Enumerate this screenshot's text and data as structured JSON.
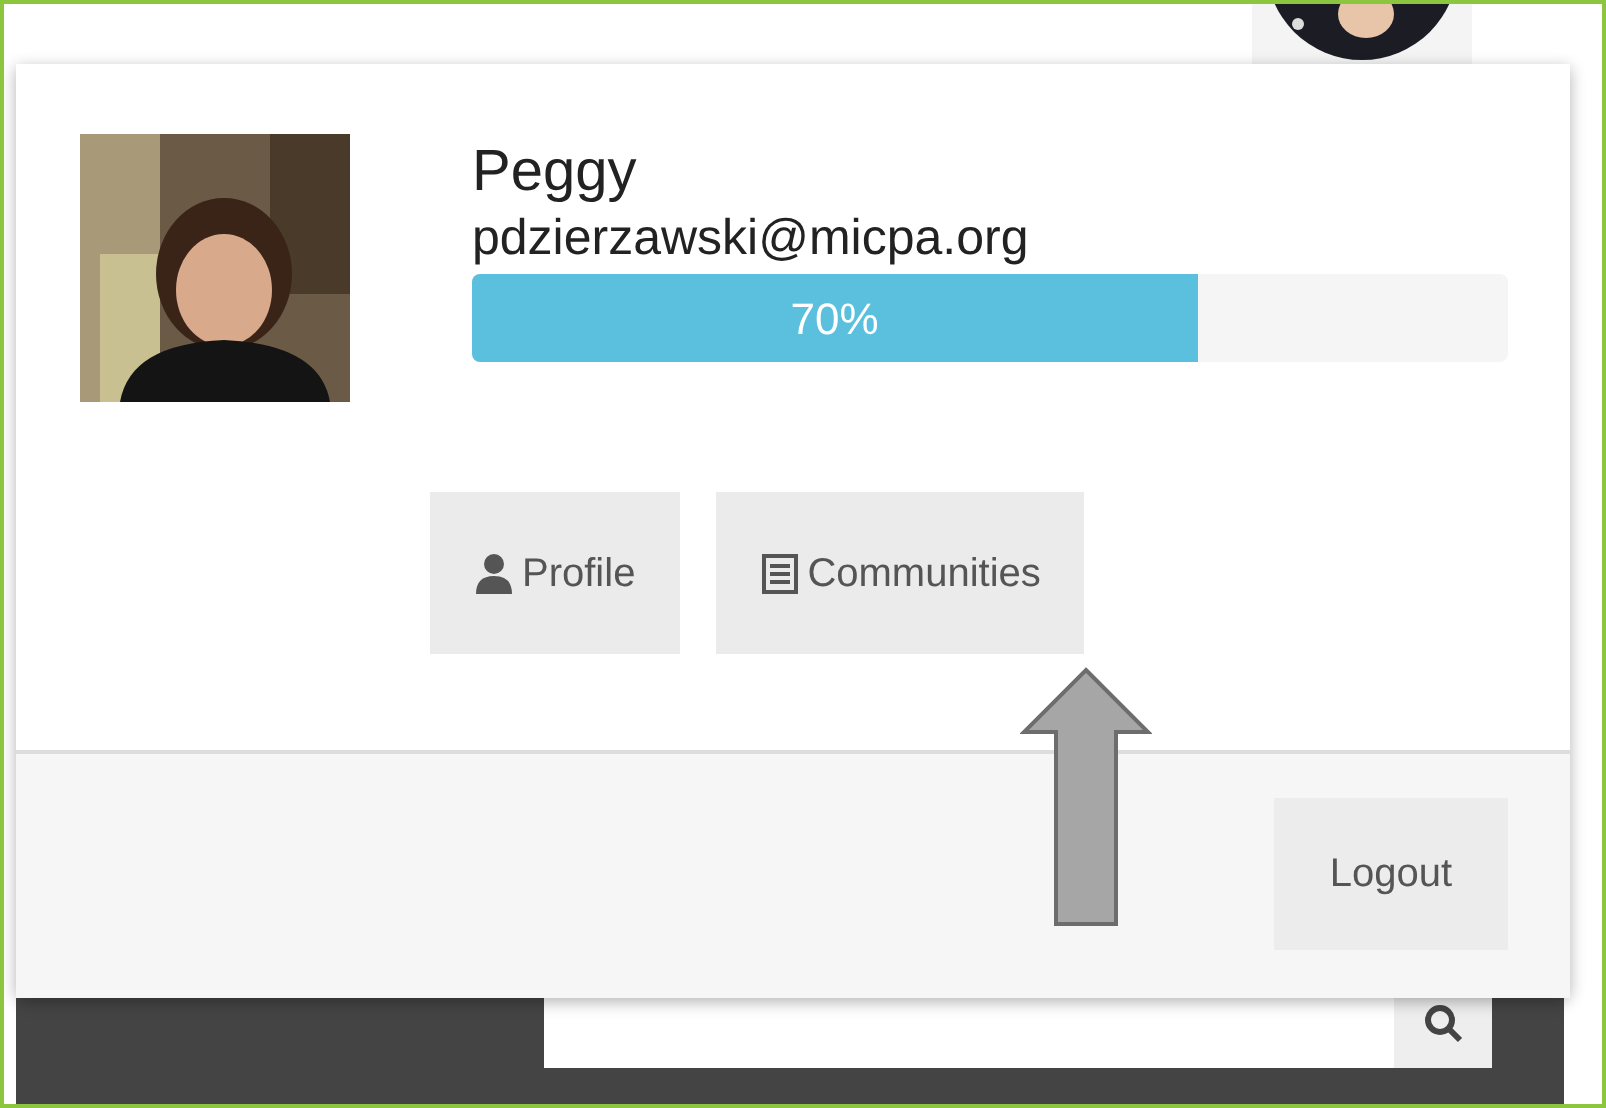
{
  "user": {
    "name": "Peggy",
    "email": "pdzierzawski@micpa.org"
  },
  "profile_completion": {
    "level": 0.7,
    "reading": "70%"
  },
  "buttons": [
    {
      "label": "Profile",
      "kind": "profile"
    },
    {
      "label": "Communities",
      "kind": "communities"
    }
  ],
  "logout": {
    "label": "Logout"
  }
}
